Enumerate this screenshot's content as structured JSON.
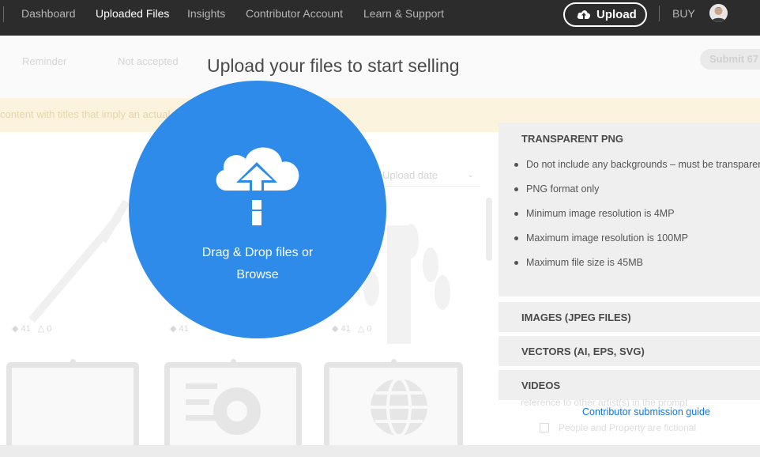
{
  "nav": {
    "links": [
      "Dashboard",
      "Uploaded Files",
      "Insights",
      "Contributor Account",
      "Learn & Support"
    ],
    "active": "Uploaded Files",
    "upload_label": "Upload",
    "buy_label": "BUY"
  },
  "background": {
    "tabs": [
      "Reminder",
      "Not accepted"
    ],
    "submit_label": "Submit 67",
    "banner_text": "content with titles that imply an actual",
    "sort_label": "Upload date"
  },
  "modal": {
    "title": "Upload your files to start selling",
    "drop_text_line1": "Drag & Drop files or",
    "drop_text_line2": "Browse"
  },
  "requirements": {
    "transparent_png": {
      "title": "TRANSPARENT PNG",
      "items": [
        "Do not include any backgrounds – must be transparent",
        "PNG format only",
        "Minimum image resolution is 4MP",
        "Maximum image resolution is 100MP",
        "Maximum file size is 45MB"
      ]
    },
    "images_title": "IMAGES (JPEG FILES)",
    "vectors_title": "VECTORS (AI, EPS, SVG)",
    "videos_title": "VIDEOS",
    "guide_link": "Contributor submission guide",
    "ghost_reference": "reference to other artist(s) in the prompt",
    "ghost_checkbox": "People and Property are fictional"
  },
  "colors": {
    "accent_blue": "#2f8bea",
    "nav_bg": "#2c2c2c",
    "link_blue": "#1473e6"
  },
  "icons": [
    "cloud-upload-icon",
    "upload-cloud-icon",
    "avatar"
  ]
}
